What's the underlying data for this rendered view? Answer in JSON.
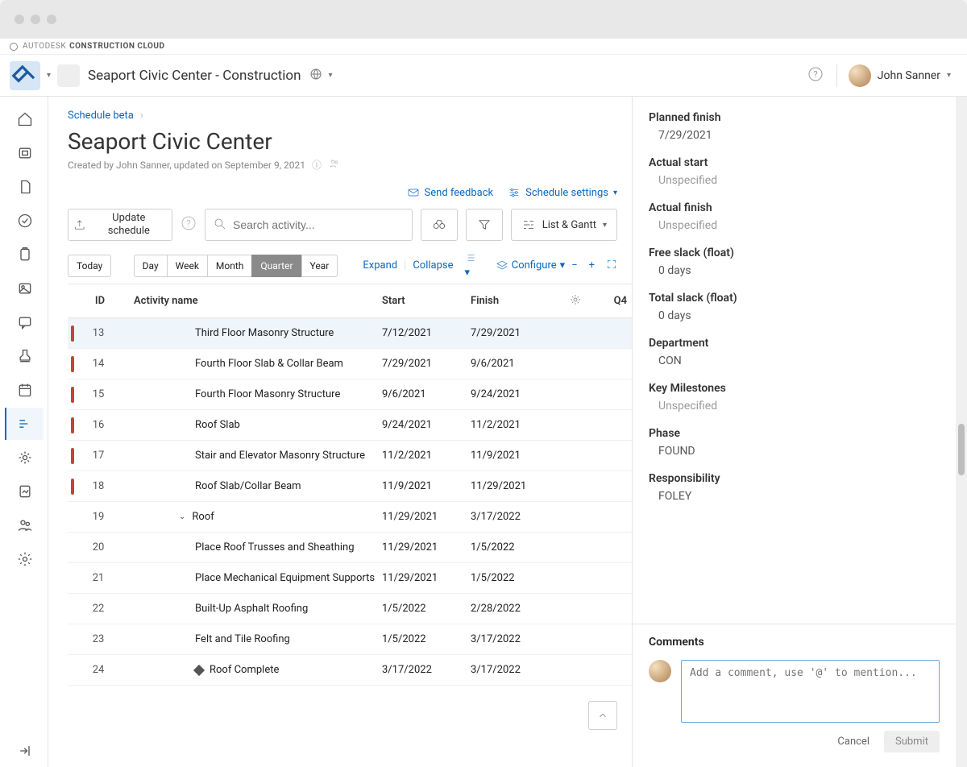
{
  "brand": {
    "name1": "AUTODESK",
    "name2": "CONSTRUCTION CLOUD"
  },
  "topbar": {
    "project_name": "Seaport Civic Center - Construction",
    "user_name": "John Sanner"
  },
  "breadcrumb": {
    "item": "Schedule beta"
  },
  "page_title": "Seaport Civic Center",
  "page_meta": "Created by John Sanner, updated on September 9, 2021",
  "actions": {
    "send_feedback": "Send feedback",
    "schedule_settings": "Schedule settings"
  },
  "toolbar": {
    "update_schedule": "Update schedule",
    "search_placeholder": "Search activity...",
    "view_label": "List & Gantt"
  },
  "segments": {
    "today": "Today",
    "day": "Day",
    "week": "Week",
    "month": "Month",
    "quarter": "Quarter",
    "year": "Year",
    "expand": "Expand",
    "collapse": "Collapse",
    "configure": "Configure"
  },
  "table": {
    "headers": {
      "id": "ID",
      "activity": "Activity name",
      "start": "Start",
      "finish": "Finish",
      "q": "Q4"
    },
    "rows": [
      {
        "id": "13",
        "act": "Third Floor Masonry Structure",
        "start": "7/12/2021",
        "finish": "7/29/2021",
        "red": true,
        "sel": true,
        "indent": 1
      },
      {
        "id": "14",
        "act": "Fourth Floor Slab & Collar Beam",
        "start": "7/29/2021",
        "finish": "9/6/2021",
        "red": true,
        "indent": 1
      },
      {
        "id": "15",
        "act": "Fourth Floor Masonry Structure",
        "start": "9/6/2021",
        "finish": "9/24/2021",
        "red": true,
        "indent": 1
      },
      {
        "id": "16",
        "act": "Roof Slab",
        "start": "9/24/2021",
        "finish": "11/2/2021",
        "red": true,
        "indent": 1
      },
      {
        "id": "17",
        "act": "Stair and Elevator Masonry Structure",
        "start": "11/2/2021",
        "finish": "11/9/2021",
        "red": true,
        "indent": 1
      },
      {
        "id": "18",
        "act": "Roof Slab/Collar Beam",
        "start": "11/9/2021",
        "finish": "11/29/2021",
        "red": true,
        "indent": 1
      },
      {
        "id": "19",
        "act": "Roof",
        "start": "11/29/2021",
        "finish": "3/17/2022",
        "group": true,
        "indent": 2
      },
      {
        "id": "20",
        "act": "Place Roof Trusses and Sheathing",
        "start": "11/29/2021",
        "finish": "1/5/2022",
        "indent": 1
      },
      {
        "id": "21",
        "act": "Place Mechanical Equipment Supports",
        "start": "11/29/2021",
        "finish": "1/5/2022",
        "indent": 1
      },
      {
        "id": "22",
        "act": "Built-Up Asphalt Roofing",
        "start": "1/5/2022",
        "finish": "2/28/2022",
        "indent": 1
      },
      {
        "id": "23",
        "act": "Felt and Tile Roofing",
        "start": "1/5/2022",
        "finish": "3/17/2022",
        "indent": 1
      },
      {
        "id": "24",
        "act": "Roof Complete",
        "start": "3/17/2022",
        "finish": "3/17/2022",
        "milestone": true,
        "indent": 1
      }
    ]
  },
  "details": {
    "planned_finish": {
      "label": "Planned finish",
      "value": "7/29/2021"
    },
    "actual_start": {
      "label": "Actual start",
      "value": "Unspecified",
      "unspec": true
    },
    "actual_finish": {
      "label": "Actual finish",
      "value": "Unspecified",
      "unspec": true
    },
    "free_slack": {
      "label": "Free slack (float)",
      "value": "0 days"
    },
    "total_slack": {
      "label": "Total slack (float)",
      "value": "0 days"
    },
    "department": {
      "label": "Department",
      "value": "CON"
    },
    "key_milestones": {
      "label": "Key Milestones",
      "value": "Unspecified",
      "unspec": true
    },
    "phase": {
      "label": "Phase",
      "value": "FOUND"
    },
    "responsibility": {
      "label": "Responsibility",
      "value": "FOLEY"
    }
  },
  "comments": {
    "header": "Comments",
    "placeholder": "Add a comment, use '@' to mention...",
    "cancel": "Cancel",
    "submit": "Submit"
  }
}
